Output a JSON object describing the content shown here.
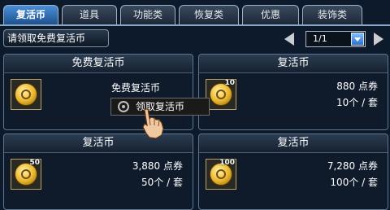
{
  "tabs": [
    {
      "label": "复活币",
      "active": true
    },
    {
      "label": "道具",
      "active": false
    },
    {
      "label": "功能类",
      "active": false
    },
    {
      "label": "恢复类",
      "active": false
    },
    {
      "label": "优惠",
      "active": false
    },
    {
      "label": "装饰类",
      "active": false
    }
  ],
  "topbar": {
    "hint": "请领取免费复活币",
    "page": "1/1"
  },
  "cards": [
    {
      "title": "免费复活币",
      "label": "免费复活币",
      "icon_qty": "",
      "price": "",
      "qty": ""
    },
    {
      "title": "复活币",
      "label": "",
      "icon_qty": "10",
      "price": "880 点券",
      "qty": "10个 / 套"
    },
    {
      "title": "复活币",
      "label": "",
      "icon_qty": "50",
      "price": "3,880 点券",
      "qty": "50个 / 套"
    },
    {
      "title": "复活币",
      "label": "",
      "icon_qty": "100",
      "price": "7,280 点券",
      "qty": "100个 / 套"
    }
  ],
  "popup": {
    "claim_label": "领取复活币"
  },
  "icons": {
    "coin": "revive-coin-icon",
    "cursor": "hand-pointer-icon"
  }
}
